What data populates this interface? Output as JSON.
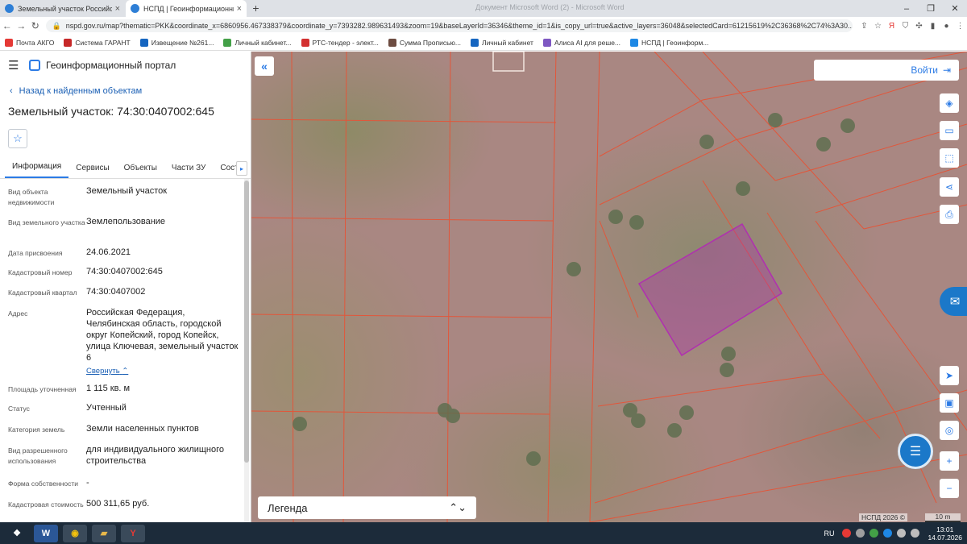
{
  "browser": {
    "tabs": [
      {
        "title": "Земельный участок Российска"
      },
      {
        "title": "НСПД | Геоинформационный п"
      }
    ],
    "window_title": "Документ Microsoft Word (2) - Microsoft Word",
    "url": "nspd.gov.ru/map?thematic=PKK&coordinate_x=6860956.467338379&coordinate_y=7393282.989631493&zoom=19&baseLayerId=36346&theme_id=1&is_copy_url=true&active_layers=36048&selectedCard=61215619%2C36368%2C74%3A30..."
  },
  "bookmarks": [
    {
      "label": "Почта АКГО",
      "color": "#e53935"
    },
    {
      "label": "Система ГАРАНТ",
      "color": "#c62828"
    },
    {
      "label": "Извещение №261...",
      "color": "#1565c0"
    },
    {
      "label": "Личный кабинет...",
      "color": "#43a047"
    },
    {
      "label": "РТС-тендер - элект...",
      "color": "#d32f2f"
    },
    {
      "label": "Сумма Прописью...",
      "color": "#6d4c41"
    },
    {
      "label": "Личный кабинет",
      "color": "#1565c0"
    },
    {
      "label": "Алиса AI для реше...",
      "color": "#7e57c2"
    },
    {
      "label": "НСПД | Геоинформ...",
      "color": "#1e88e5"
    }
  ],
  "panel": {
    "portal_title": "Геоинформационный портал",
    "back_label": "Назад к найденным объектам",
    "title": "Земельный участок: 74:30:0407002:645",
    "tabs": [
      "Информация",
      "Сервисы",
      "Объекты",
      "Части ЗУ",
      "Состав"
    ],
    "fields": [
      {
        "label": "Вид объекта недвижимости",
        "value": "Земельный участок"
      },
      {
        "label": "Вид земельного участка",
        "value": "Землепользование"
      },
      {
        "label": "Дата присвоения",
        "value": "24.06.2021"
      },
      {
        "label": "Кадастровый номер",
        "value": "74:30:0407002:645"
      },
      {
        "label": "Кадастровый квартал",
        "value": "74:30:0407002"
      },
      {
        "label": "Адрес",
        "value": "Российская Федерация, Челябинская область, городской округ Копейский, город Копейск, улица Ключевая, земельный участок 6"
      },
      {
        "label": "Площадь уточненная",
        "value": "1 115 кв. м"
      },
      {
        "label": "Статус",
        "value": "Учтенный"
      },
      {
        "label": "Категория земель",
        "value": "Земли населенных пунктов"
      },
      {
        "label": "Вид разрешенного использования",
        "value": "для индивидуального жилищного строительства"
      },
      {
        "label": "Форма собственности",
        "value": "-"
      },
      {
        "label": "Кадастровая стоимость",
        "value": "500 311,65 руб."
      }
    ],
    "collapse_label": "Свернуть"
  },
  "map": {
    "login_label": "Войти",
    "legend_label": "Легенда",
    "attribution": "НСПД 2026 ©",
    "scale_label": "10 m",
    "parcel_color": "#b02fb0",
    "boundary_color": "#e2563a"
  },
  "taskbar": {
    "lang": "RU",
    "time": "13:01",
    "date": "14.07.2026"
  }
}
